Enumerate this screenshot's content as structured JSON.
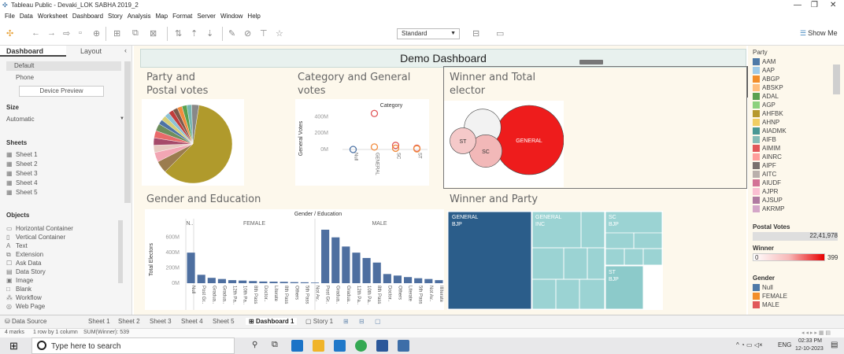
{
  "window": {
    "title": "Tableau Public - Devaki_LOK SABHA 2019_2",
    "minimize": "—",
    "maximize": "❐",
    "close": "✕"
  },
  "menu": [
    "File",
    "Data",
    "Worksheet",
    "Dashboard",
    "Story",
    "Analysis",
    "Map",
    "Format",
    "Server",
    "Window",
    "Help"
  ],
  "toolbar": {
    "view_select": "Standard",
    "show_me": "Show Me"
  },
  "left": {
    "tab_dashboard": "Dashboard",
    "tab_layout": "Layout",
    "device_default": "Default",
    "device_phone": "Phone",
    "device_preview": "Device Preview",
    "size_head": "Size",
    "size_value": "Automatic",
    "sheets_head": "Sheets",
    "sheets": [
      "Sheet 1",
      "Sheet 2",
      "Sheet 3",
      "Sheet 4",
      "Sheet 5"
    ],
    "objects_head": "Objects",
    "objects": [
      "Horizontal Container",
      "Vertical Container",
      "Text",
      "Extension",
      "Ask Data",
      "Data Story",
      "Image",
      "Blank",
      "Workflow",
      "Web Page"
    ]
  },
  "dashboard": {
    "title": "Demo Dashboard",
    "p1_title_l1": "Party and",
    "p1_title_l2": "Postal votes",
    "p2_title_l1": "Category and General",
    "p2_title_l2": "votes",
    "p3_title_l1": "Winner and Total",
    "p3_title_l2": "elector",
    "p4_title": "Gender and Education",
    "p5_title": "Winner and Party"
  },
  "chart_data": [
    {
      "type": "pie",
      "title": "",
      "slices": [
        {
          "value": 60,
          "color": "#b09a2c"
        },
        {
          "value": 5,
          "color": "#9b7c4f"
        },
        {
          "value": 4,
          "color": "#f2a6b4"
        },
        {
          "value": 3,
          "color": "#e7c9c1"
        },
        {
          "value": 3,
          "color": "#a54a6a"
        },
        {
          "value": 3,
          "color": "#e96a6a"
        },
        {
          "value": 3,
          "color": "#6d8e5c"
        },
        {
          "value": 2,
          "color": "#4d73a5"
        },
        {
          "value": 2,
          "color": "#d6cf76"
        },
        {
          "value": 2,
          "color": "#8dc2d6"
        },
        {
          "value": 2,
          "color": "#c03c3c"
        },
        {
          "value": 2,
          "color": "#7b5a4c"
        },
        {
          "value": 2,
          "color": "#f28b3d"
        },
        {
          "value": 2,
          "color": "#59a14f"
        },
        {
          "value": 2,
          "color": "#76b7b2"
        },
        {
          "value": 3,
          "color": "#888888"
        }
      ]
    },
    {
      "type": "scatter",
      "title": "Category",
      "ylabel": "General Votes",
      "categories": [
        "Null",
        "GENERAL",
        "SC",
        "ST"
      ],
      "yticks": [
        "400M",
        "200M",
        "0M"
      ],
      "ylim": [
        0,
        500
      ],
      "points": [
        {
          "cat": 0,
          "y": 0,
          "color": "#4d73a5"
        },
        {
          "cat": 1,
          "y": 30,
          "color": "#f28b3d"
        },
        {
          "cat": 1,
          "y": 440,
          "color": "#e15759"
        },
        {
          "cat": 2,
          "y": 50,
          "color": "#e15759"
        },
        {
          "cat": 2,
          "y": 15,
          "color": "#f28b3d"
        },
        {
          "cat": 3,
          "y": 15,
          "color": "#e15759"
        },
        {
          "cat": 3,
          "y": 8,
          "color": "#f28b3d"
        }
      ]
    },
    {
      "type": "bubble",
      "title": "",
      "bubbles": [
        {
          "label": "GENERAL",
          "size": 100,
          "color": "#ee1c1c"
        },
        {
          "label": "",
          "size": 28,
          "color": "#f2f2f2"
        },
        {
          "label": "SC",
          "size": 22,
          "color": "#f2b8b8"
        },
        {
          "label": "ST",
          "size": 14,
          "color": "#f5c9c9"
        }
      ]
    },
    {
      "type": "bar",
      "title": "Gender / Education",
      "ylabel": "Total Electors",
      "groups": [
        "N..",
        "FEMALE",
        "MALE"
      ],
      "yticks": [
        "600M",
        "400M",
        "200M",
        "0M"
      ],
      "ylim": [
        0,
        700
      ],
      "categories": [
        "Null",
        "Post Gr..",
        "Gradua..",
        "Gradua..",
        "12th Pa..",
        "10th Pa..",
        "8th Pass",
        "Doctor..",
        "Literate",
        "8th Pass",
        "Others",
        "5th Pass",
        "Not Av..",
        "Post Gr..",
        "Gradua..",
        "Gradua..",
        "12th Pa..",
        "10th Pa..",
        "8th Pass",
        "Doctor..",
        "Others",
        "Literate",
        "5th Pass",
        "Not Av..",
        "Illiterate"
      ],
      "values": [
        400,
        110,
        70,
        55,
        40,
        35,
        28,
        22,
        20,
        18,
        14,
        12,
        8,
        720,
        600,
        480,
        400,
        330,
        270,
        120,
        100,
        80,
        65,
        55,
        40
      ]
    },
    {
      "type": "treemap",
      "title": "",
      "labels": [
        {
          "l1": "GENERAL",
          "l2": "BJP"
        },
        {
          "l1": "GENERAL",
          "l2": "INC"
        },
        {
          "l1": "SC",
          "l2": "BJP"
        },
        {
          "l1": "ST",
          "l2": "BJP"
        }
      ]
    }
  ],
  "legend": {
    "party_head": "Party",
    "party": [
      {
        "name": "AAM",
        "color": "#4e79a7"
      },
      {
        "name": "AAP",
        "color": "#a0cbe8"
      },
      {
        "name": "ABGP",
        "color": "#f28e2b"
      },
      {
        "name": "ABSKP",
        "color": "#ffbe7d"
      },
      {
        "name": "ADAL",
        "color": "#59a14f"
      },
      {
        "name": "AGP",
        "color": "#8cd17d"
      },
      {
        "name": "AHFBK",
        "color": "#b6992d"
      },
      {
        "name": "AHNP",
        "color": "#f1ce63"
      },
      {
        "name": "AIADMK",
        "color": "#499894"
      },
      {
        "name": "AIFB",
        "color": "#86bcb6"
      },
      {
        "name": "AIMIM",
        "color": "#e15759"
      },
      {
        "name": "AINRC",
        "color": "#ff9d9a"
      },
      {
        "name": "AIPF",
        "color": "#79706e"
      },
      {
        "name": "AITC",
        "color": "#bab0ac"
      },
      {
        "name": "AIUDF",
        "color": "#d37295"
      },
      {
        "name": "AJPR",
        "color": "#fabfd2"
      },
      {
        "name": "AJSUP",
        "color": "#b07aa1"
      },
      {
        "name": "AKRMP",
        "color": "#d4a6c8"
      }
    ],
    "postal_head": "Postal Votes",
    "postal_value": "22,41,978",
    "winner_head": "Winner",
    "winner_min": "0",
    "winner_max": "399",
    "gender_head": "Gender",
    "gender": [
      {
        "name": "Null",
        "color": "#4e79a7"
      },
      {
        "name": "FEMALE",
        "color": "#f28e2b"
      },
      {
        "name": "MALE",
        "color": "#e15759"
      }
    ]
  },
  "tabs": {
    "data_source": "Data Source",
    "items": [
      "Sheet 1",
      "Sheet 2",
      "Sheet 3",
      "Sheet 4",
      "Sheet 5",
      "Dashboard 1",
      "Story 1"
    ]
  },
  "status": {
    "marks": "4 marks",
    "rows": "1 row by 1 column",
    "sum": "SUM(Winner): 539"
  },
  "taskbar": {
    "search_placeholder": "Type here to search",
    "lang": "ENG",
    "time": "02:33 PM",
    "date": "12-10-2023"
  }
}
